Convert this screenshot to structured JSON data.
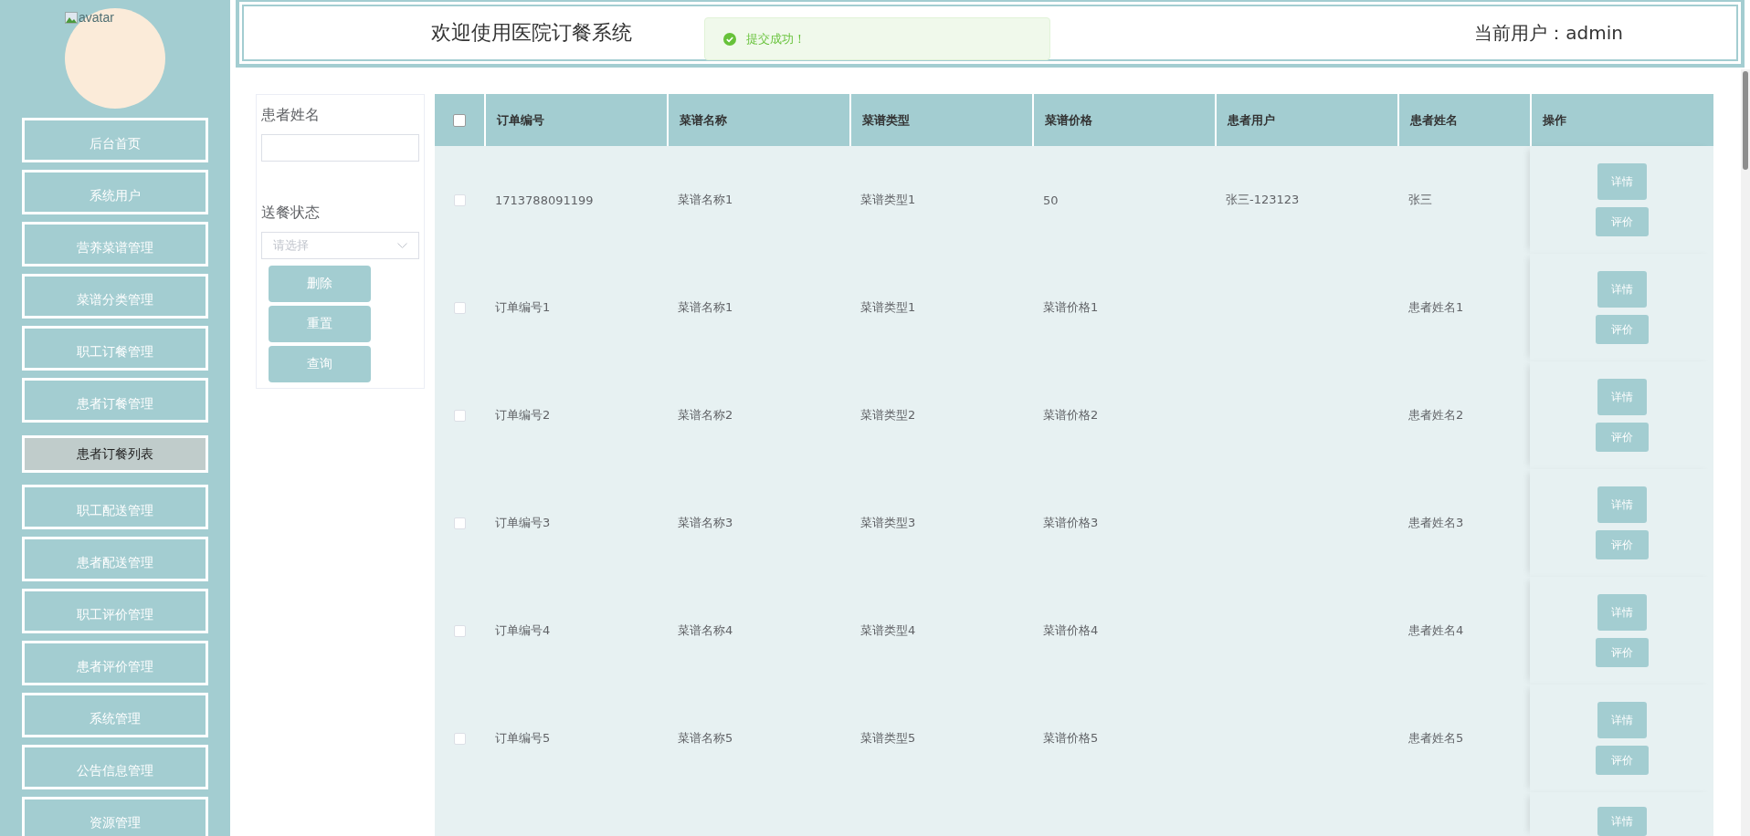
{
  "sidebar": {
    "avatar_alt": "avatar",
    "items": [
      {
        "label": "后台首页",
        "selected": false
      },
      {
        "label": "系统用户",
        "selected": false
      },
      {
        "label": "营养菜谱管理",
        "selected": false
      },
      {
        "label": "菜谱分类管理",
        "selected": false
      },
      {
        "label": "职工订餐管理",
        "selected": false
      },
      {
        "label": "患者订餐管理",
        "selected": false
      },
      {
        "label": "患者订餐列表",
        "selected": true
      },
      {
        "label": "职工配送管理",
        "selected": false
      },
      {
        "label": "患者配送管理",
        "selected": false
      },
      {
        "label": "职工评价管理",
        "selected": false
      },
      {
        "label": "患者评价管理",
        "selected": false
      },
      {
        "label": "系统管理",
        "selected": false
      },
      {
        "label": "公告信息管理",
        "selected": false
      },
      {
        "label": "资源管理",
        "selected": false
      }
    ]
  },
  "header": {
    "title": "欢迎使用医院订餐系统",
    "user": "当前用户：admin"
  },
  "toast": {
    "kind": "success",
    "message": "提交成功！"
  },
  "filters": {
    "fields": [
      {
        "kind": "text",
        "label": "患者姓名"
      },
      {
        "kind": "select",
        "label": "送餐状态",
        "placeholder": "请选择"
      }
    ],
    "buttons": [
      "删除",
      "重置",
      "查询"
    ]
  },
  "table": {
    "all_checked": false,
    "columns": [
      "订单编号",
      "菜谱名称",
      "菜谱类型",
      "菜谱价格",
      "患者用户",
      "患者姓名",
      "操作"
    ],
    "rows": [
      {
        "checked": false,
        "cells": [
          "1713788091199",
          "菜谱名称1",
          "菜谱类型1",
          "50",
          "张三-123123",
          "张三"
        ],
        "actions": [
          "详情",
          "评价"
        ]
      },
      {
        "checked": false,
        "cells": [
          "订单编号1",
          "菜谱名称1",
          "菜谱类型1",
          "菜谱价格1",
          null,
          "患者姓名1"
        ],
        "actions": [
          "详情",
          "评价"
        ]
      },
      {
        "checked": false,
        "cells": [
          "订单编号2",
          "菜谱名称2",
          "菜谱类型2",
          "菜谱价格2",
          null,
          "患者姓名2"
        ],
        "actions": [
          "详情",
          "评价"
        ]
      },
      {
        "checked": false,
        "cells": [
          "订单编号3",
          "菜谱名称3",
          "菜谱类型3",
          "菜谱价格3",
          null,
          "患者姓名3"
        ],
        "actions": [
          "详情",
          "评价"
        ]
      },
      {
        "checked": false,
        "cells": [
          "订单编号4",
          "菜谱名称4",
          "菜谱类型4",
          "菜谱价格4",
          null,
          "患者姓名4"
        ],
        "actions": [
          "详情",
          "评价"
        ]
      },
      {
        "checked": false,
        "cells": [
          "订单编号5",
          "菜谱名称5",
          "菜谱类型5",
          "菜谱价格5",
          null,
          "患者姓名5"
        ],
        "actions": [
          "详情",
          "评价"
        ]
      },
      {
        "actions": [
          "详情"
        ]
      }
    ]
  }
}
